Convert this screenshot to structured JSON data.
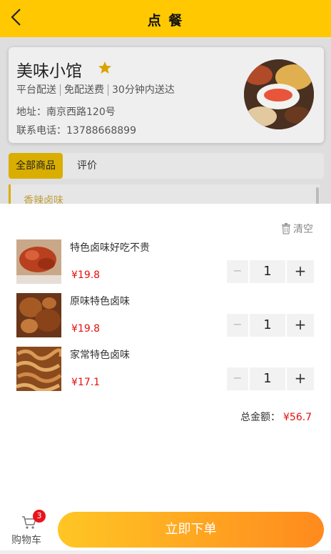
{
  "header": {
    "title": "点 餐",
    "back_icon": "chevron-left-icon"
  },
  "shop": {
    "name": "美味小馆",
    "star_icon": "star-icon",
    "tags": [
      "平台配送",
      "免配送费",
      "30分钟内送达"
    ],
    "address": "地址：南京西路120号",
    "phone": "联系电话：13788668899"
  },
  "tabs": [
    {
      "label": "全部商品",
      "active": true
    },
    {
      "label": "评价",
      "active": false
    }
  ],
  "category": {
    "label": "香辣卤味"
  },
  "cart": {
    "clear_label": "清空",
    "items": [
      {
        "name": "特色卤味好吃不贵",
        "price": "¥19.8",
        "qty": "1"
      },
      {
        "name": "原味特色卤味",
        "price": "¥19.8",
        "qty": "1"
      },
      {
        "name": "家常特色卤味",
        "price": "¥17.1",
        "qty": "1"
      }
    ],
    "stepper": {
      "minus": "−",
      "plus": "+"
    },
    "total_label": "总金额：",
    "total_value": "¥56.7"
  },
  "bottom": {
    "cart_label": "购物车",
    "badge_count": "3",
    "order_label": "立即下单"
  },
  "colors": {
    "brand_yellow": "#FFC800",
    "price_red": "#e31010",
    "order_gradient_start": "#FFC624",
    "order_gradient_end": "#FF8A1E"
  }
}
